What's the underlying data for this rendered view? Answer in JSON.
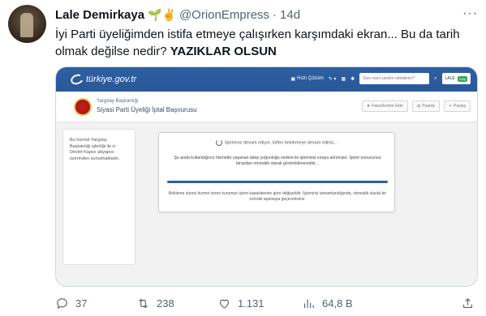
{
  "author": {
    "name": "Lale Demirkaya",
    "emojis": "🌱✌",
    "handle": "@OrionEmpress",
    "separator": "·",
    "time": "14d"
  },
  "more_label": "···",
  "tweet": {
    "text_plain": "İyi Parti üyeliğimden istifa etmeye çalışırken karşımdaki ekran... Bu da tarih olmak değilse nedir? ",
    "text_bold": "YAZIKLAR OLSUN"
  },
  "screenshot": {
    "logo_text": "türkiye.gov.tr",
    "nav": {
      "exit_label": "Hızlı Çözüm",
      "search_placeholder": "Size nasıl yardım edebilirim?",
      "user_label": "LALE",
      "user_badge": "Giriş"
    },
    "institution": "Yargıtay Başkanlığı",
    "page_title": "Siyasi Parti Üyeliği İptal Başvurusu",
    "buttons": [
      "Favorilerime Ekle",
      "Puanla",
      "Paylaş"
    ],
    "sidebar_text": "Bu hizmet Yargıtay Başkanlığı işbirliği ile e-Devlet Kapısı altyapısı üzerinden sunulmaktadır.",
    "dialog": {
      "waiting": "İşleminiz devam ediyor, lütfen beklemeye devam ediniz...",
      "message": "Şu anda kullandığınız hizmette yaşanan talep yoğunluğu nedeni ile işleminiz sıraya alınmıştır. İşlem sonucunuz birazdan otomatik olarak görüntülenecektir...",
      "note": "Bekleme süresi hizmet veren kurumun işlem kapasitesine göre değişebilir. İşleminiz tamamlandığında, otomatik olarak bir sonraki aşamaya geçeceksiniz."
    }
  },
  "actions": {
    "replies": "37",
    "retweets": "238",
    "likes": "1.131",
    "views": "64,8 B"
  }
}
